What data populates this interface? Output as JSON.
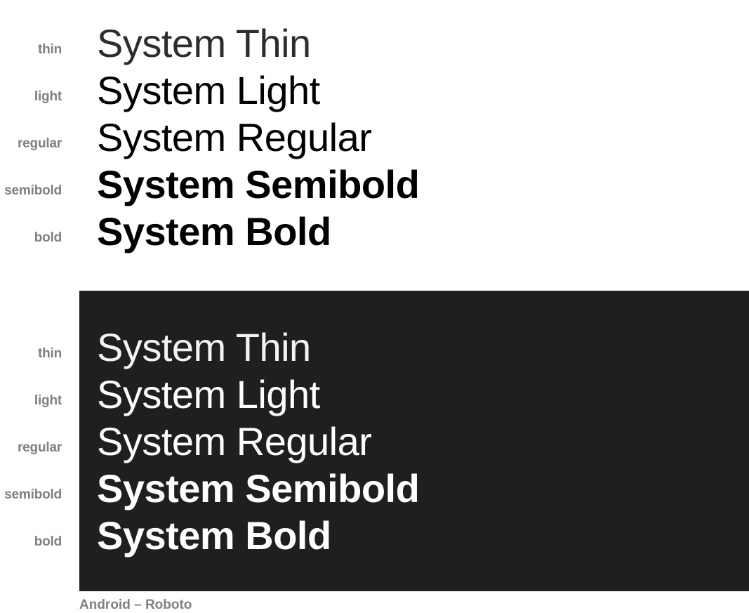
{
  "light_theme": {
    "rows": [
      {
        "label": "thin",
        "sample": "System Thin"
      },
      {
        "label": "light",
        "sample": "System Light"
      },
      {
        "label": "regular",
        "sample": "System Regular"
      },
      {
        "label": "semibold",
        "sample": "System Semibold"
      },
      {
        "label": "bold",
        "sample": "System Bold"
      }
    ]
  },
  "dark_theme": {
    "background": "#1f1f1f",
    "rows": [
      {
        "label": "thin",
        "sample": "System Thin"
      },
      {
        "label": "light",
        "sample": "System Light"
      },
      {
        "label": "regular",
        "sample": "System Regular"
      },
      {
        "label": "semibold",
        "sample": "System Semibold"
      },
      {
        "label": "bold",
        "sample": "System Bold"
      }
    ]
  },
  "caption": "Android – Roboto"
}
